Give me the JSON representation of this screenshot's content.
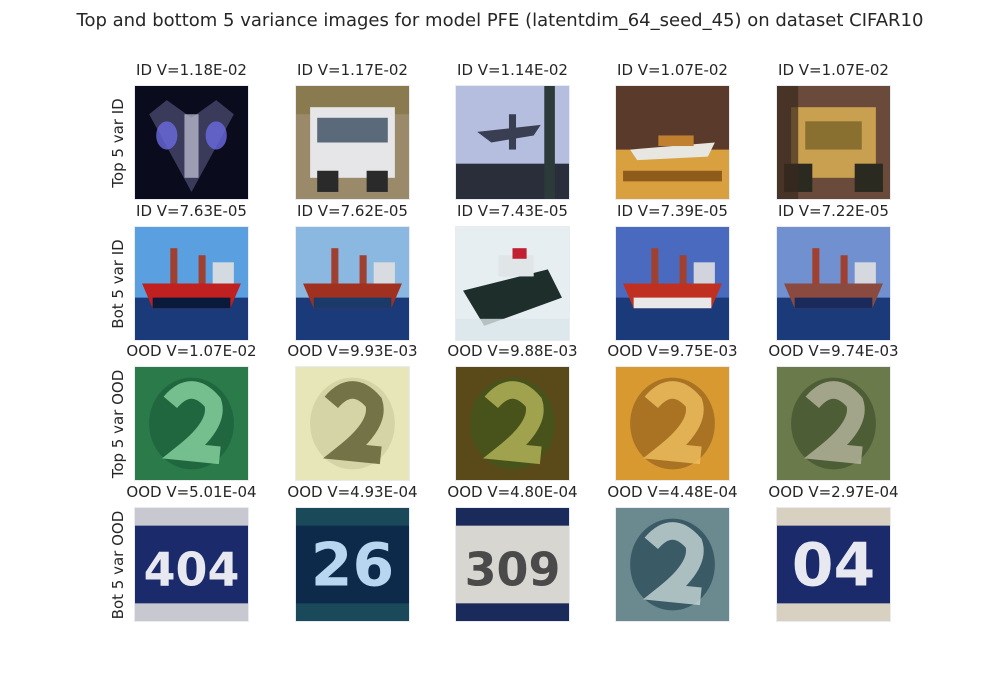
{
  "figure": {
    "title": "Top and bottom 5 variance images for model PFE (latentdim_64_seed_45) on dataset CIFAR10"
  },
  "rows": [
    {
      "label": "Top 5 var ID",
      "images": [
        {
          "title": "ID V=1.18E-02",
          "subject": "dark fighter jet / spaceship with blue glow",
          "bg": "#0b0b1e",
          "mid": "#3a3a5a",
          "accent": "#6a6ae0",
          "kind": "jet"
        },
        {
          "title": "ID V=1.17E-02",
          "subject": "white truck",
          "bg": "#9a8a6a",
          "mid": "#e6e6e8",
          "accent": "#2a2a2a",
          "kind": "truck"
        },
        {
          "title": "ID V=1.14E-02",
          "subject": "airplane against sky behind fence",
          "bg": "#b6bee0",
          "mid": "#3a3e52",
          "accent": "#2c3a3a",
          "kind": "plane-sky"
        },
        {
          "title": "ID V=1.07E-02",
          "subject": "small plane on orange ground",
          "bg": "#5a3a2a",
          "mid": "#d9a040",
          "accent": "#e8e6e0",
          "kind": "plane-ground"
        },
        {
          "title": "ID V=1.07E-02",
          "subject": "yellow dump truck",
          "bg": "#6a4a3a",
          "mid": "#c9a050",
          "accent": "#2a2a20",
          "kind": "dumptruck"
        }
      ]
    },
    {
      "label": "Bot 5 var ID",
      "images": [
        {
          "title": "ID V=7.63E-05",
          "subject": "red cargo ship",
          "bg": "#5aa0e0",
          "mid": "#c02020",
          "accent": "#0a1a3a",
          "kind": "ship"
        },
        {
          "title": "ID V=7.62E-05",
          "subject": "container ship",
          "bg": "#8ab8e0",
          "mid": "#a03020",
          "accent": "#1a3a6a",
          "kind": "ship"
        },
        {
          "title": "ID V=7.43E-05",
          "subject": "dark ship on white water",
          "bg": "#e6eef2",
          "mid": "#1e2e2a",
          "accent": "#c02030",
          "kind": "ship2"
        },
        {
          "title": "ID V=7.39E-05",
          "subject": "red tug boat",
          "bg": "#4a6ac0",
          "mid": "#c03020",
          "accent": "#e8e8e8",
          "kind": "ship"
        },
        {
          "title": "ID V=7.22E-05",
          "subject": "ship on blue sea",
          "bg": "#7090d0",
          "mid": "#8a4a40",
          "accent": "#1a2a5a",
          "kind": "ship"
        }
      ]
    },
    {
      "label": "Top 5 var OOD",
      "images": [
        {
          "title": "OOD V=1.07E-02",
          "subject": "blurry green house number",
          "bg": "#2a7a4a",
          "mid": "#8ad6a0",
          "accent": "#1a5a3a",
          "kind": "digit"
        },
        {
          "title": "OOD V=9.93E-03",
          "subject": "blurry pale house number",
          "bg": "#e6e6b8",
          "mid": "#5a5a30",
          "accent": "#c8c89a",
          "kind": "digit"
        },
        {
          "title": "OOD V=9.88E-03",
          "subject": "blurry digit 2 on olive",
          "bg": "#5a4a1a",
          "mid": "#b6b65a",
          "accent": "#3a5a1a",
          "kind": "digit"
        },
        {
          "title": "OOD V=9.75E-03",
          "subject": "blurry orange house number",
          "bg": "#d89a30",
          "mid": "#f0c060",
          "accent": "#8a5a1a",
          "kind": "digit"
        },
        {
          "title": "OOD V=9.74E-03",
          "subject": "blurry greenish house number",
          "bg": "#6a7a4a",
          "mid": "#b8b8a0",
          "accent": "#3a4a2a",
          "kind": "digit"
        }
      ]
    },
    {
      "label": "Bot 5 var OOD",
      "images": [
        {
          "title": "OOD V=5.01E-04",
          "subject": "house number 404 blue plate",
          "bg": "#1a2a6a",
          "mid": "#e8e8f0",
          "accent": "#c8c8d0",
          "kind": "plate",
          "text": "404"
        },
        {
          "title": "OOD V=4.93E-04",
          "subject": "house number 26 dark teal",
          "bg": "#0e2a4a",
          "mid": "#b8d6f0",
          "accent": "#1a4a5a",
          "kind": "plate",
          "text": "26"
        },
        {
          "title": "OOD V=4.80E-04",
          "subject": "house number 309 grey plate",
          "bg": "#d8d6d0",
          "mid": "#4a4a4a",
          "accent": "#1a2a5a",
          "kind": "plate",
          "text": "309"
        },
        {
          "title": "OOD V=4.48E-04",
          "subject": "blurry teal house number",
          "bg": "#6a8a90",
          "mid": "#c8d8d8",
          "accent": "#1a3a4a",
          "kind": "digit"
        },
        {
          "title": "OOD V=2.97E-04",
          "subject": "house number 04 blue plate",
          "bg": "#1a2a6a",
          "mid": "#e8e8f0",
          "accent": "#d8d0c0",
          "kind": "plate",
          "text": "04"
        }
      ]
    }
  ]
}
